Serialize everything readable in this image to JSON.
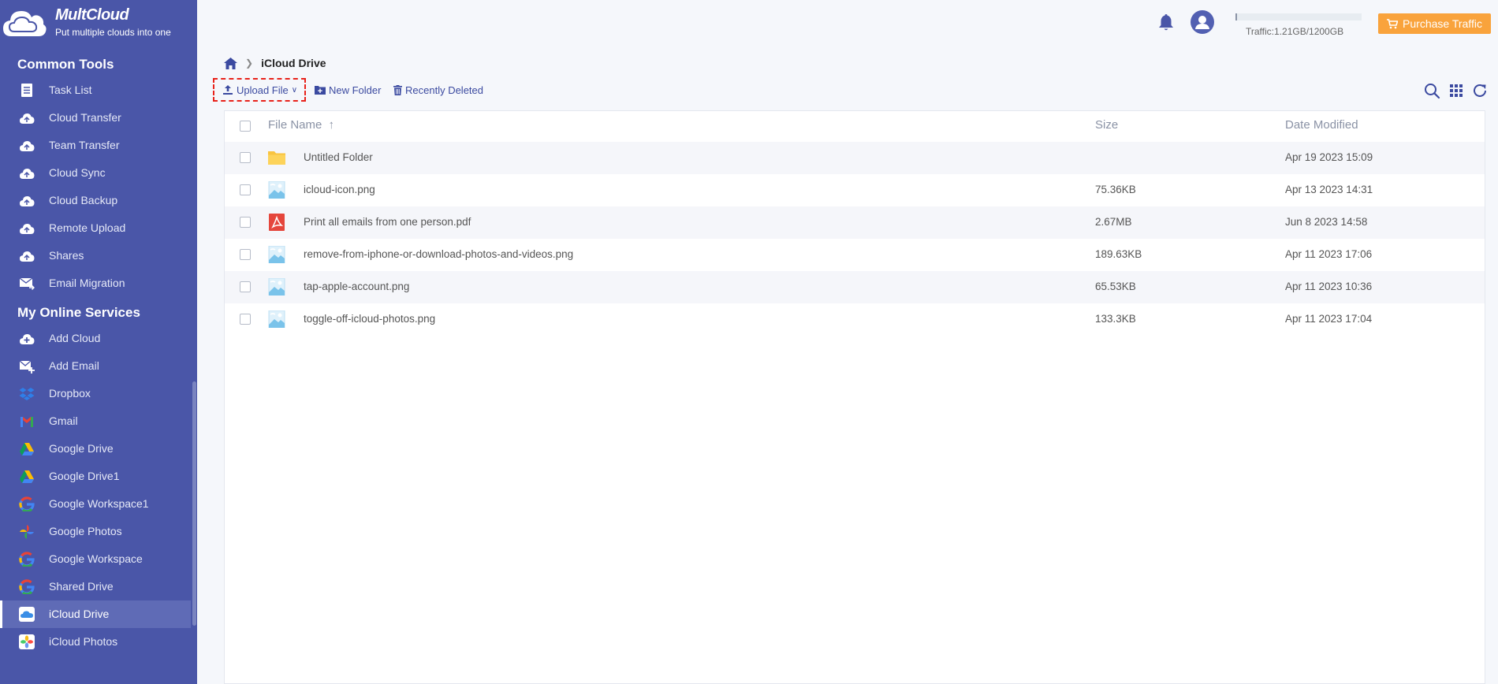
{
  "app": {
    "name": "MultCloud",
    "tagline": "Put multiple clouds into one"
  },
  "sidebar": {
    "common_tools_title": "Common Tools",
    "common_tools": [
      {
        "label": "Task List",
        "icon": "task-list-icon"
      },
      {
        "label": "Cloud Transfer",
        "icon": "cloud-transfer-icon"
      },
      {
        "label": "Team Transfer",
        "icon": "team-transfer-icon"
      },
      {
        "label": "Cloud Sync",
        "icon": "cloud-sync-icon"
      },
      {
        "label": "Cloud Backup",
        "icon": "cloud-backup-icon"
      },
      {
        "label": "Remote Upload",
        "icon": "remote-upload-icon"
      },
      {
        "label": "Shares",
        "icon": "shares-icon"
      },
      {
        "label": "Email Migration",
        "icon": "email-migration-icon"
      }
    ],
    "online_services_title": "My Online Services",
    "online_services": [
      {
        "label": "Add Cloud",
        "icon": "add-cloud-icon"
      },
      {
        "label": "Add Email",
        "icon": "add-email-icon"
      },
      {
        "label": "Dropbox",
        "icon": "dropbox-icon"
      },
      {
        "label": "Gmail",
        "icon": "gmail-icon"
      },
      {
        "label": "Google Drive",
        "icon": "google-drive-icon"
      },
      {
        "label": "Google Drive1",
        "icon": "google-drive-icon"
      },
      {
        "label": "Google Workspace1",
        "icon": "google-workspace-icon"
      },
      {
        "label": "Google Photos",
        "icon": "google-photos-icon"
      },
      {
        "label": "Google Workspace",
        "icon": "google-workspace-icon"
      },
      {
        "label": "Shared Drive",
        "icon": "shared-drive-icon"
      },
      {
        "label": "iCloud Drive",
        "icon": "icloud-drive-icon",
        "active": true
      },
      {
        "label": "iCloud Photos",
        "icon": "icloud-photos-icon"
      }
    ]
  },
  "header": {
    "traffic_text": "Traffic:1.21GB/1200GB",
    "traffic_used_fraction": 0.001,
    "purchase_label": "Purchase Traffic"
  },
  "breadcrumb": {
    "current": "iCloud Drive"
  },
  "toolbar": {
    "upload_label": "Upload File",
    "new_folder_label": "New Folder",
    "recently_deleted_label": "Recently Deleted"
  },
  "table": {
    "columns": {
      "name": "File Name",
      "size": "Size",
      "date": "Date Modified"
    },
    "rows": [
      {
        "name": "Untitled Folder",
        "type": "folder",
        "size": "",
        "date": "Apr 19 2023 15:09"
      },
      {
        "name": "icloud-icon.png",
        "type": "image",
        "size": "75.36KB",
        "date": "Apr 13 2023 14:31"
      },
      {
        "name": "Print all emails from one person.pdf",
        "type": "pdf",
        "size": "2.67MB",
        "date": "Jun 8 2023 14:58"
      },
      {
        "name": "remove-from-iphone-or-download-photos-and-videos.png",
        "type": "image",
        "size": "189.63KB",
        "date": "Apr 11 2023 17:06"
      },
      {
        "name": "tap-apple-account.png",
        "type": "image",
        "size": "65.53KB",
        "date": "Apr 11 2023 10:36"
      },
      {
        "name": "toggle-off-icloud-photos.png",
        "type": "image",
        "size": "133.3KB",
        "date": "Apr 11 2023 17:04"
      }
    ]
  },
  "colors": {
    "sidebar_bg": "#4a56a8",
    "accent": "#3b4aa0",
    "purchase": "#f9a33c",
    "highlight_border": "#e8221a"
  }
}
